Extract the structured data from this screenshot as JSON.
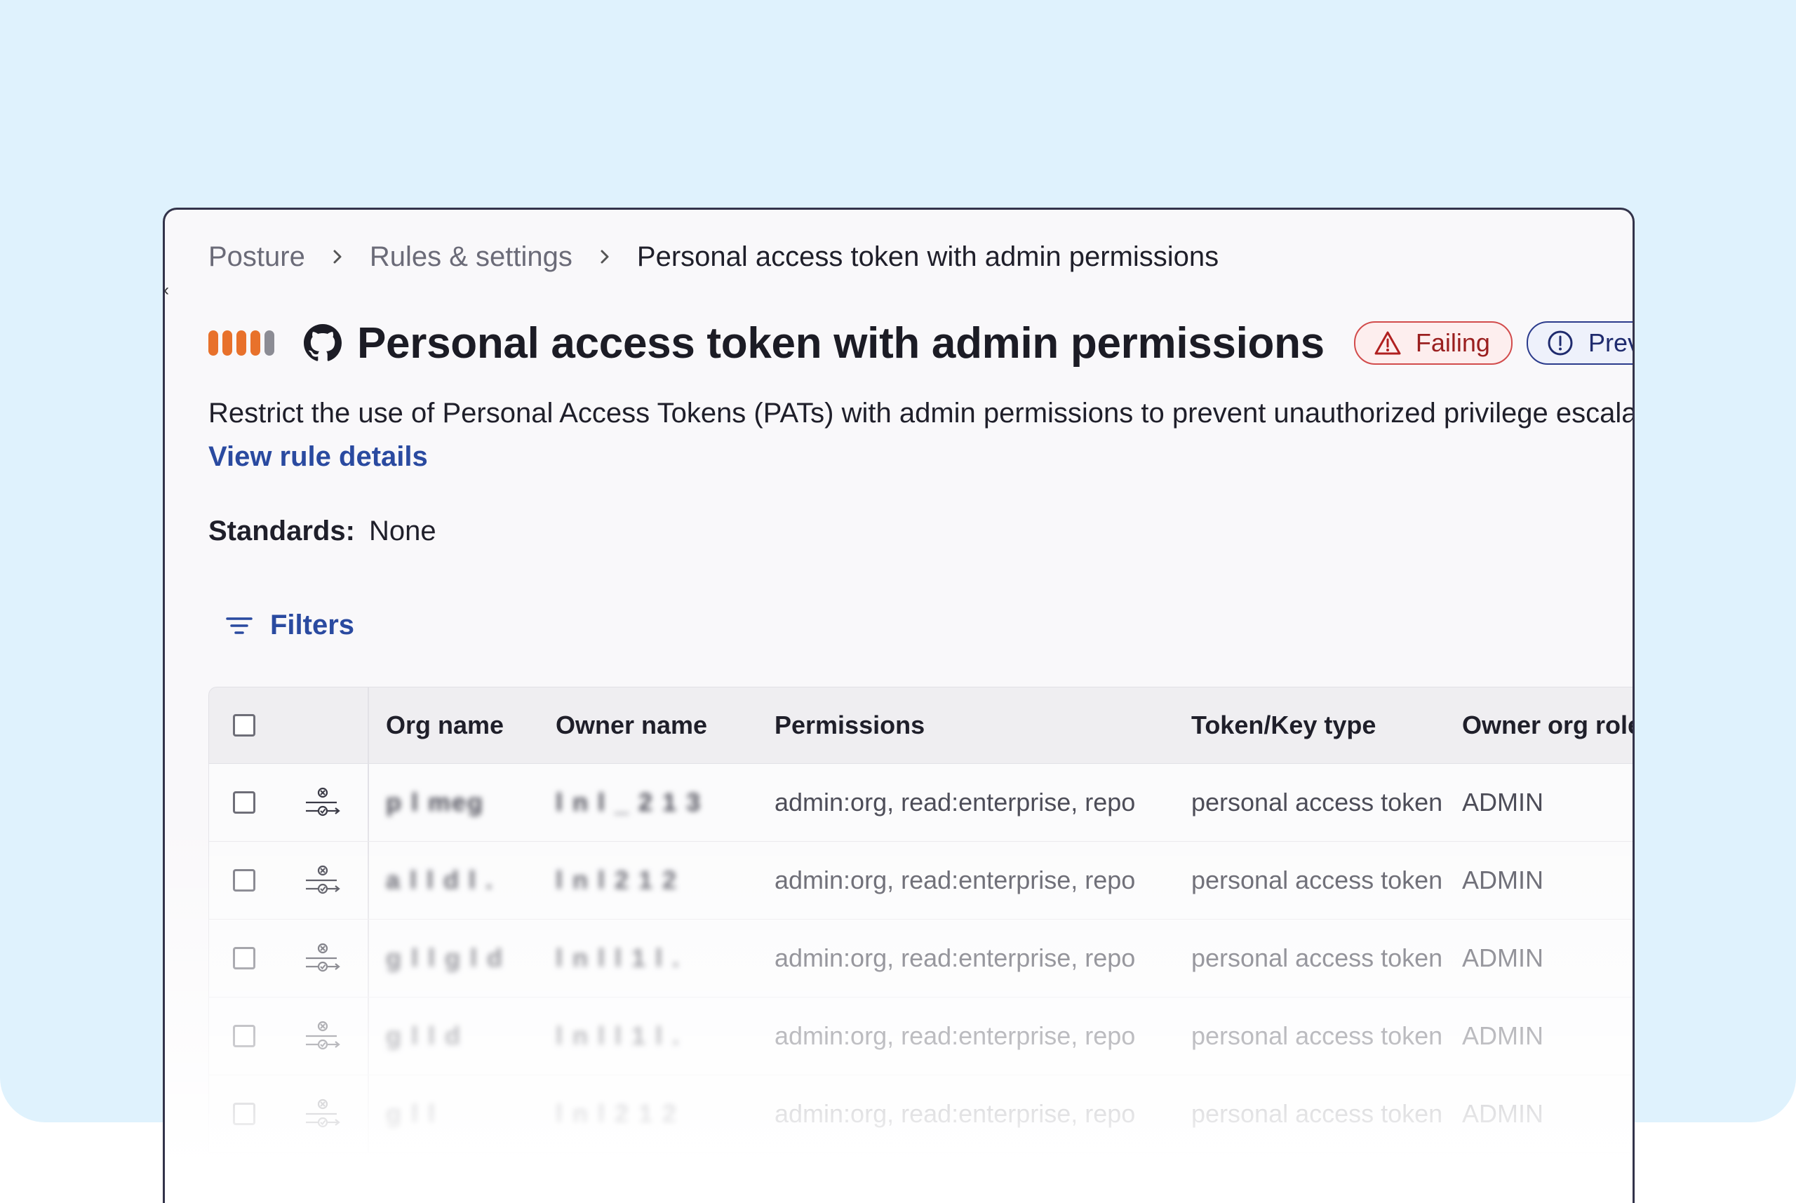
{
  "breadcrumb": {
    "items": [
      "Posture",
      "Rules & settings",
      "Personal access token with admin permissions"
    ]
  },
  "header": {
    "title": "Personal access token with admin permissions",
    "severity_colors": [
      "#e8712b",
      "#e8712b",
      "#e8712b",
      "#e8712b",
      "#8c8c94"
    ],
    "badges": {
      "failing": "Failing",
      "preview": "Preview (trans"
    }
  },
  "description": "Restrict the use of Personal Access Tokens (PATs) with admin permissions to prevent unauthorized privilege escalatio",
  "view_rule_details": "View rule details",
  "standards": {
    "label": "Standards:",
    "value": "None"
  },
  "filters": {
    "label": "Filters"
  },
  "table": {
    "columns": [
      "Org name",
      "Owner name",
      "Permissions",
      "Token/Key type",
      "Owner org role"
    ],
    "rows": [
      {
        "org": "p l  meg",
        "owner": "l n l  _ 2 1 3",
        "permissions": "admin:org, read:enterprise, repo",
        "type": "personal access token",
        "role": "ADMIN"
      },
      {
        "org": "a l  l d l .",
        "owner": "l n l  2 1 2",
        "permissions": "admin:org, read:enterprise, repo",
        "type": "personal access token",
        "role": "ADMIN"
      },
      {
        "org": "g l  l g l d",
        "owner": "l n l  l 1 l .",
        "permissions": "admin:org, read:enterprise, repo",
        "type": "personal access token",
        "role": "ADMIN"
      },
      {
        "org": "g l  l d",
        "owner": "l n l  l 1 l .",
        "permissions": "admin:org, read:enterprise, repo",
        "type": "personal access token",
        "role": "ADMIN"
      },
      {
        "org": "g l  l",
        "owner": "l n l  2 1 2",
        "permissions": "admin:org, read:enterprise, repo",
        "type": "personal access token",
        "role": "ADMIN"
      }
    ]
  }
}
